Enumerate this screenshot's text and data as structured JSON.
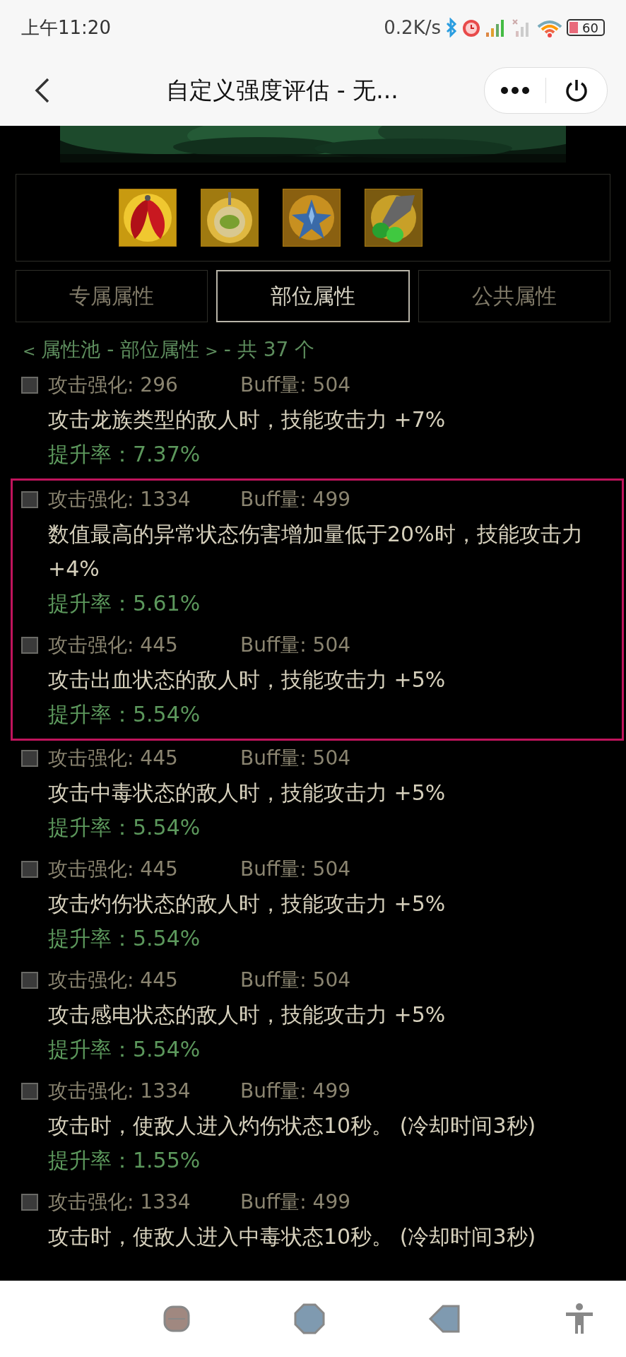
{
  "status_bar": {
    "time": "上午11:20",
    "speed": "0.2K/s",
    "battery": "60"
  },
  "header": {
    "title": "自定义强度评估 - 无..."
  },
  "equipment_icons": [
    {
      "kind": "wings"
    },
    {
      "kind": "lantern"
    },
    {
      "kind": "star"
    },
    {
      "kind": "gem"
    }
  ],
  "tabs": [
    {
      "label": "专属属性",
      "selected": false
    },
    {
      "label": "部位属性",
      "selected": true
    },
    {
      "label": "公共属性",
      "selected": false
    }
  ],
  "pool_label": {
    "open": "<",
    "name": "属性池 - 部位属性",
    "close": ">",
    "count": "- 共 37 个"
  },
  "items": [
    {
      "checked": false,
      "highlighted": false,
      "attack": "攻击强化: 296",
      "buff": "Buff量: 504",
      "description": "攻击龙族类型的敌人时，技能攻击力 +7%",
      "rate": "提升率：7.37%"
    },
    {
      "checked": false,
      "highlighted": true,
      "attack": "攻击强化: 1334",
      "buff": "Buff量: 499",
      "description": "数值最高的异常状态伤害增加量低于20%时，技能攻击力 +4%",
      "rate": "提升率：5.61%"
    },
    {
      "checked": false,
      "highlighted": true,
      "attack": "攻击强化: 445",
      "buff": "Buff量: 504",
      "description": "攻击出血状态的敌人时，技能攻击力 +5%",
      "rate": "提升率：5.54%"
    },
    {
      "checked": false,
      "highlighted": false,
      "attack": "攻击强化: 445",
      "buff": "Buff量: 504",
      "description": "攻击中毒状态的敌人时，技能攻击力 +5%",
      "rate": "提升率：5.54%"
    },
    {
      "checked": false,
      "highlighted": false,
      "attack": "攻击强化: 445",
      "buff": "Buff量: 504",
      "description": "攻击灼伤状态的敌人时，技能攻击力 +5%",
      "rate": "提升率：5.54%"
    },
    {
      "checked": false,
      "highlighted": false,
      "attack": "攻击强化: 445",
      "buff": "Buff量: 504",
      "description": "攻击感电状态的敌人时，技能攻击力 +5%",
      "rate": "提升率：5.54%"
    },
    {
      "checked": false,
      "highlighted": false,
      "attack": "攻击强化: 1334",
      "buff": "Buff量: 499",
      "description": "攻击时，使敌人进入灼伤状态10秒。 (冷却时间3秒)",
      "rate": "提升率：1.55%"
    },
    {
      "checked": false,
      "highlighted": false,
      "attack": "攻击强化: 1334",
      "buff": "Buff量: 499",
      "description": "攻击时，使敌人进入中毒状态10秒。 (冷却时间3秒)"
    }
  ]
}
